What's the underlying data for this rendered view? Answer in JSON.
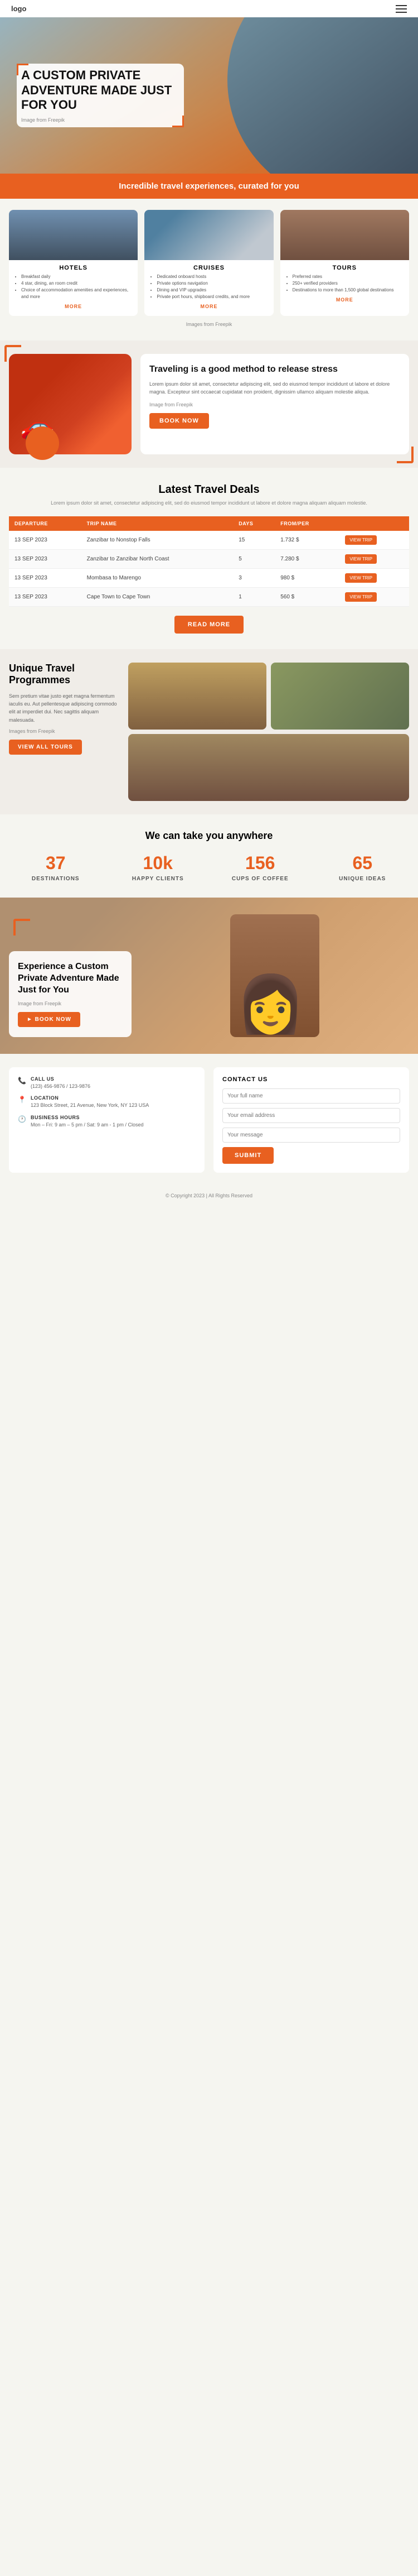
{
  "header": {
    "logo": "logo",
    "menu_icon": "≡"
  },
  "hero": {
    "title": "A CUSTOM PRIVATE ADVENTURE MADE JUST FOR YOU",
    "freepik_note": "Image from Freepik"
  },
  "banner": {
    "text": "Incredible travel experiences, curated for you"
  },
  "services": {
    "freepik_note": "Images from Freepik",
    "cards": [
      {
        "title": "HOTELS",
        "bullets": [
          "Breakfast daily",
          "4 star, dining, an room credit",
          "Choice of accommodation amenities and experiences, and more"
        ],
        "more": "MORE"
      },
      {
        "title": "CRUISES",
        "bullets": [
          "Dedicated onboard hosts",
          "Private options navigation",
          "Dining and VIP upgrades",
          "Private port hours, shipboard credits, and more"
        ],
        "more": "MORE"
      },
      {
        "title": "TOURS",
        "bullets": [
          "Preferred rates",
          "250+ verified providers",
          "Destinations to more than 1,500 global destinations"
        ],
        "more": "MORE"
      }
    ]
  },
  "stress": {
    "heading": "Traveling is a good method to release stress",
    "body": "Lorem ipsum dolor sit amet, consectetur adipiscing elit, sed do eiusmod tempor incididunt ut labore et dolore magna. Excepteur sint occaecat cupidatat non proident, dignissim ullamco aliquam molestie aliqua.",
    "freepik_note": "Image from Freepik",
    "book_btn": "BOOK NOW"
  },
  "deals": {
    "heading": "Latest Travel Deals",
    "subtext": "Lorem ipsum dolor sit amet, consectetur adipiscing elit, sed do eiusmod tempor incididunt ut labore et dolore magna aliquam aliquam molestie.",
    "columns": [
      "DEPARTURE",
      "TRIP NAME",
      "DAYS",
      "FROM/PER",
      ""
    ],
    "rows": [
      {
        "departure": "13 SEP 2023",
        "trip": "Zanzibar to Nonstop Falls",
        "days": "15",
        "price": "1.732 $",
        "btn": "VIEW TRIP"
      },
      {
        "departure": "13 SEP 2023",
        "trip": "Zanzibar to Zanzibar North Coast",
        "days": "5",
        "price": "7.280 $",
        "btn": "VIEW TRIP"
      },
      {
        "departure": "13 SEP 2023",
        "trip": "Mombasa to Marengo",
        "days": "3",
        "price": "980 $",
        "btn": "VIEW TRIP"
      },
      {
        "departure": "13 SEP 2023",
        "trip": "Cape Town to Cape Town",
        "days": "1",
        "price": "560 $",
        "btn": "VIEW TRIP"
      }
    ],
    "read_more": "READ MORE"
  },
  "programmes": {
    "heading": "Unique Travel Programmes",
    "body": "Sem pretium vitae justo eget magna fermentum iaculis eu. Aut pellentesque adipiscing commodo elit at imperdiet dui. Nec sagittis aliquam malesuada.",
    "freepik_note": "Images from Freepik",
    "btn": "VIEW ALL TOURS"
  },
  "stats": {
    "heading": "We can take you anywhere",
    "items": [
      {
        "number": "37",
        "label": "DESTINATIONS"
      },
      {
        "number": "10k",
        "label": "HAPPY CLIENTS"
      },
      {
        "number": "156",
        "label": "CUPS OF COFFEE"
      },
      {
        "number": "65",
        "label": "UNIQUE IDEAS"
      }
    ]
  },
  "adventure": {
    "heading": "Experience a Custom Private Adventure Made Just for You",
    "freepik_note": "Image from Freepik",
    "btn": "► BOOK NOW"
  },
  "footer": {
    "contact_info_title": "CALL US",
    "phone": "(123) 456-9876 / 123-9876",
    "location_title": "LOCATION",
    "address": "123 Block Street, 21 Avenue, New York, NY 123 USA",
    "hours_title": "BUSINESS HOURS",
    "hours": "Mon – Fri: 9 am – 5 pm / Sat: 9 am - 1 pm / Closed",
    "contact_form_title": "Contact Us",
    "form_fields": {
      "name_placeholder": "Your full name",
      "email_placeholder": "Your email address",
      "message_placeholder": "Your message"
    },
    "submit_btn": "SUBMIT"
  },
  "footer_bottom": {
    "text": "© Copyright 2023 | All Rights Reserved"
  }
}
